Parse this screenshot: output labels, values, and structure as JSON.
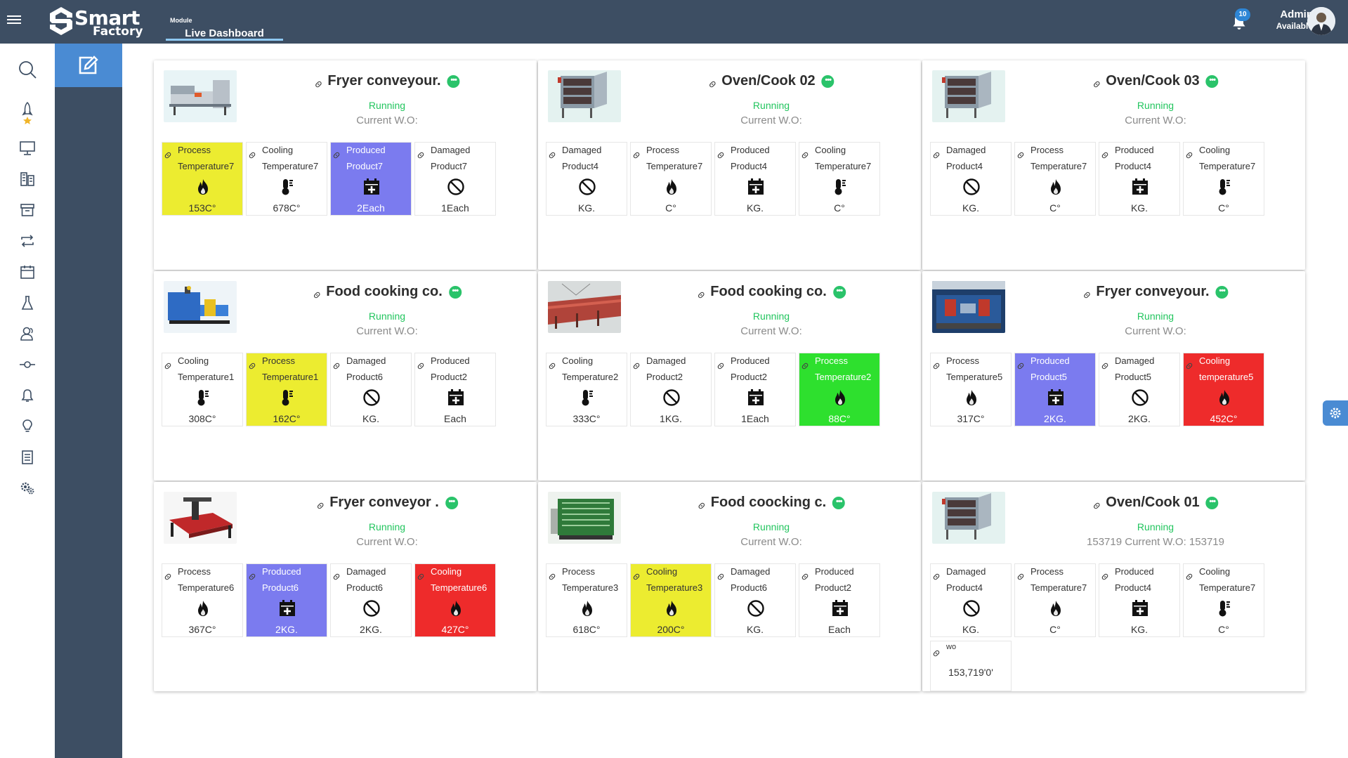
{
  "header": {
    "brand_top": "Smart",
    "brand_bottom": "Factory",
    "module_label": "Module",
    "module_value": "Live Dashboard",
    "notifications_count": "10",
    "user_name": "Admin",
    "user_status": "Available"
  },
  "leftbar": {
    "icons": [
      "search-icon",
      "rocket-icon",
      "monitor-icon",
      "buildings-icon",
      "archive-icon",
      "transfer-icon",
      "calendar-icon",
      "flask-icon",
      "users-icon",
      "commit-icon",
      "bell-icon",
      "lightbulb-icon",
      "document-icon",
      "settings-icon"
    ],
    "help": "?"
  },
  "colors": {
    "yellow": "#ecec30",
    "blue": "#7b7bef",
    "green": "#2ee02e",
    "red": "#ee2b2b",
    "status": "#22c55e",
    "header": "#3d4e63",
    "accent": "#4a8bd3"
  },
  "cards": [
    {
      "title": "Fryer conveyour.",
      "status": "Running",
      "wo": "Current W.O:",
      "image": "fryer-machine",
      "tiles": [
        {
          "l1": "Process",
          "l2": "Temperature7",
          "icon": "flame-icon",
          "value": "153C°",
          "color": "yellow"
        },
        {
          "l1": "Cooling",
          "l2": "Temperature7",
          "icon": "thermometer-icon",
          "value": "678C°",
          "color": ""
        },
        {
          "l1": "Produced",
          "l2": "Product7",
          "icon": "calendar-plus-icon",
          "value": "2Each",
          "color": "blue"
        },
        {
          "l1": "Damaged",
          "l2": "Product7",
          "icon": "ban-icon",
          "value": "1Each",
          "color": ""
        }
      ]
    },
    {
      "title": "Oven/Cook 02",
      "status": "Running",
      "wo": "Current W.O:",
      "image": "oven",
      "tiles": [
        {
          "l1": "Damaged",
          "l2": "Product4",
          "icon": "ban-icon",
          "value": "KG.",
          "color": ""
        },
        {
          "l1": "Process",
          "l2": "Temperature7",
          "icon": "flame-icon",
          "value": "C°",
          "color": ""
        },
        {
          "l1": "Produced",
          "l2": "Product4",
          "icon": "calendar-plus-icon",
          "value": "KG.",
          "color": ""
        },
        {
          "l1": "Cooling",
          "l2": "Temperature7",
          "icon": "thermometer-icon",
          "value": "C°",
          "color": ""
        }
      ]
    },
    {
      "title": "Oven/Cook 03",
      "status": "Running",
      "wo": "Current W.O:",
      "image": "oven",
      "tiles": [
        {
          "l1": "Damaged",
          "l2": "Product4",
          "icon": "ban-icon",
          "value": "KG.",
          "color": ""
        },
        {
          "l1": "Process",
          "l2": "Temperature7",
          "icon": "flame-icon",
          "value": "C°",
          "color": ""
        },
        {
          "l1": "Produced",
          "l2": "Product4",
          "icon": "calendar-plus-icon",
          "value": "KG.",
          "color": ""
        },
        {
          "l1": "Cooling",
          "l2": "Temperature7",
          "icon": "thermometer-icon",
          "value": "C°",
          "color": ""
        }
      ]
    },
    {
      "title": "Food cooking co.",
      "status": "Running",
      "wo": "Current W.O:",
      "image": "blue-machine",
      "tiles": [
        {
          "l1": "Cooling",
          "l2": "Temperature1",
          "icon": "thermometer-icon",
          "value": "308C°",
          "color": ""
        },
        {
          "l1": "Process",
          "l2": "Temperature1",
          "icon": "thermometer-icon",
          "value": "162C°",
          "color": "yellow"
        },
        {
          "l1": "Damaged",
          "l2": "Product6",
          "icon": "ban-icon",
          "value": "KG.",
          "color": ""
        },
        {
          "l1": "Produced",
          "l2": "Product2",
          "icon": "calendar-plus-icon",
          "value": "Each",
          "color": ""
        }
      ]
    },
    {
      "title": "Food cooking co.",
      "status": "Running",
      "wo": "Current W.O:",
      "image": "red-conveyor",
      "tiles": [
        {
          "l1": "Cooling",
          "l2": "Temperature2",
          "icon": "thermometer-icon",
          "value": "333C°",
          "color": ""
        },
        {
          "l1": "Damaged",
          "l2": "Product2",
          "icon": "ban-icon",
          "value": "1KG.",
          "color": ""
        },
        {
          "l1": "Produced",
          "l2": "Product2",
          "icon": "calendar-plus-icon",
          "value": "1Each",
          "color": ""
        },
        {
          "l1": "Process",
          "l2": "Temperature2",
          "icon": "flame-icon",
          "value": "88C°",
          "color": "green"
        }
      ]
    },
    {
      "title": "Fryer conveyour.",
      "status": "Running",
      "wo": "Current W.O:",
      "image": "blue-factory",
      "tiles": [
        {
          "l1": "Process",
          "l2": "Temperature5",
          "icon": "flame-icon",
          "value": "317C°",
          "color": ""
        },
        {
          "l1": "Produced",
          "l2": "Product5",
          "icon": "calendar-plus-icon",
          "value": "2KG.",
          "color": "blue"
        },
        {
          "l1": "Damaged",
          "l2": "Product5",
          "icon": "ban-icon",
          "value": "2KG.",
          "color": ""
        },
        {
          "l1": "Cooling",
          "l2": "temperature5",
          "icon": "flame-icon",
          "value": "452C°",
          "color": "red"
        }
      ]
    },
    {
      "title": "Fryer conveyor .",
      "status": "Running",
      "wo": "Current W.O:",
      "image": "cnc-machine",
      "tiles": [
        {
          "l1": "Process",
          "l2": "Temperature6",
          "icon": "flame-icon",
          "value": "367C°",
          "color": ""
        },
        {
          "l1": "Produced",
          "l2": "Product6",
          "icon": "calendar-plus-icon",
          "value": "2KG.",
          "color": "blue"
        },
        {
          "l1": "Damaged",
          "l2": "Product6",
          "icon": "ban-icon",
          "value": "2KG.",
          "color": ""
        },
        {
          "l1": "Cooling",
          "l2": "Temperature6",
          "icon": "flame-icon",
          "value": "427C°",
          "color": "red"
        }
      ]
    },
    {
      "title": "Food coocking c.",
      "status": "Running",
      "wo": "Current W.O:",
      "image": "green-machine",
      "tiles": [
        {
          "l1": "Process",
          "l2": "Temperature3",
          "icon": "flame-icon",
          "value": "618C°",
          "color": ""
        },
        {
          "l1": "Cooling",
          "l2": "Temperature3",
          "icon": "flame-icon",
          "value": "200C°",
          "color": "yellow"
        },
        {
          "l1": "Damaged",
          "l2": "Product6",
          "icon": "ban-icon",
          "value": "KG.",
          "color": ""
        },
        {
          "l1": "Produced",
          "l2": "Product2",
          "icon": "calendar-plus-icon",
          "value": "Each",
          "color": ""
        }
      ]
    },
    {
      "title": "Oven/Cook 01",
      "status": "Running",
      "wo": "153719 Current W.O: 153719",
      "image": "oven",
      "tiles": [
        {
          "l1": "Damaged",
          "l2": "Product4",
          "icon": "ban-icon",
          "value": "KG.",
          "color": ""
        },
        {
          "l1": "Process",
          "l2": "Temperature7",
          "icon": "flame-icon",
          "value": "C°",
          "color": ""
        },
        {
          "l1": "Produced",
          "l2": "Product4",
          "icon": "calendar-plus-icon",
          "value": "KG.",
          "color": ""
        },
        {
          "l1": "Cooling",
          "l2": "Temperature7",
          "icon": "thermometer-icon",
          "value": "C°",
          "color": ""
        },
        {
          "l1": "wo",
          "l2": "",
          "icon": "",
          "value": "153,719'0'",
          "color": "",
          "wo": true
        }
      ]
    }
  ]
}
